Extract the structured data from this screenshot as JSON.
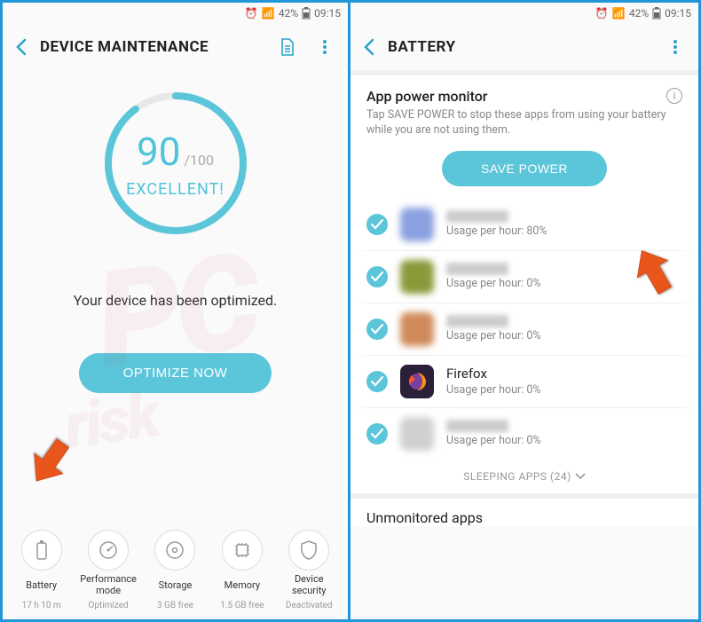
{
  "status": {
    "battery_pct": "42%",
    "time": "09:15"
  },
  "left": {
    "title": "DEVICE MAINTENANCE",
    "score": "90",
    "score_max": "/100",
    "score_label": "EXCELLENT!",
    "optimized_msg": "Your device has been optimized.",
    "optimize_btn": "OPTIMIZE NOW",
    "tiles": [
      {
        "label": "Battery",
        "sub": "17 h 10 m"
      },
      {
        "label": "Performance mode",
        "sub": "Optimized"
      },
      {
        "label": "Storage",
        "sub": "3 GB free"
      },
      {
        "label": "Memory",
        "sub": "1.5 GB free"
      },
      {
        "label": "Device security",
        "sub": "Deactivated"
      }
    ]
  },
  "right": {
    "title": "BATTERY",
    "section_title": "App power monitor",
    "section_sub": "Tap SAVE POWER to stop these apps from using your battery while you are not using them.",
    "save_btn": "SAVE POWER",
    "apps": [
      {
        "name": "",
        "usage": "Usage per hour: 80%",
        "blurred": true,
        "icon_bg": "#8aa0e0"
      },
      {
        "name": "",
        "usage": "Usage per hour: 0%",
        "blurred": true,
        "icon_bg": "#8a9a3a"
      },
      {
        "name": "",
        "usage": "Usage per hour: 0%",
        "blurred": true,
        "icon_bg": "#d08a5a"
      },
      {
        "name": "Firefox",
        "usage": "Usage per hour: 0%",
        "blurred": false,
        "icon_bg": "#2b1f3a"
      },
      {
        "name": "",
        "usage": "Usage per hour: 0%",
        "blurred": true,
        "icon_bg": "#d0d0d0"
      }
    ],
    "sleeping_label": "SLEEPING APPS (24)",
    "unmonitored_title": "Unmonitored apps"
  }
}
